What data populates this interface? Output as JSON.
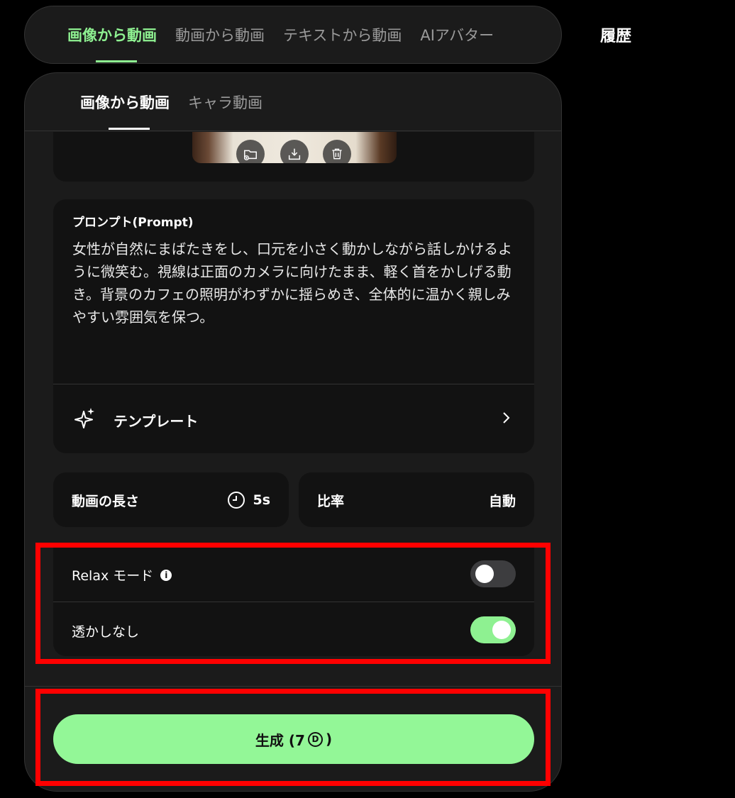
{
  "top_nav": {
    "tabs": [
      "画像から動画",
      "動画から動画",
      "テキストから動画",
      "AIアバター"
    ],
    "active_index": 0,
    "history_label": "履歴"
  },
  "sub_tabs": {
    "tabs": [
      "画像から動画",
      "キャラ動画"
    ],
    "active_index": 0
  },
  "image_actions": [
    "folder-add-icon",
    "download-icon",
    "trash-icon"
  ],
  "prompt": {
    "label": "プロンプト(Prompt)",
    "text": "女性が自然にまばたきをし、口元を小さく動かしながら話しかけるように微笑む。視線は正面のカメラに向けたまま、軽く首をかしげる動き。背景のカフェの照明がわずかに揺らめき、全体的に温かく親しみやすい雰囲気を保つ。"
  },
  "template": {
    "label": "テンプレート"
  },
  "duration": {
    "label": "動画の長さ",
    "value": "5s"
  },
  "ratio": {
    "label": "比率",
    "value": "自動"
  },
  "relax_mode": {
    "label": "Relax モード",
    "enabled": false
  },
  "no_watermark": {
    "label": "透かしなし",
    "enabled": true
  },
  "generate": {
    "label_prefix": "生成 (7",
    "coin_symbol": "D",
    "label_suffix": ")"
  },
  "colors": {
    "accent": "#8ef191",
    "button": "#93f797",
    "highlight": "#ff0000"
  }
}
